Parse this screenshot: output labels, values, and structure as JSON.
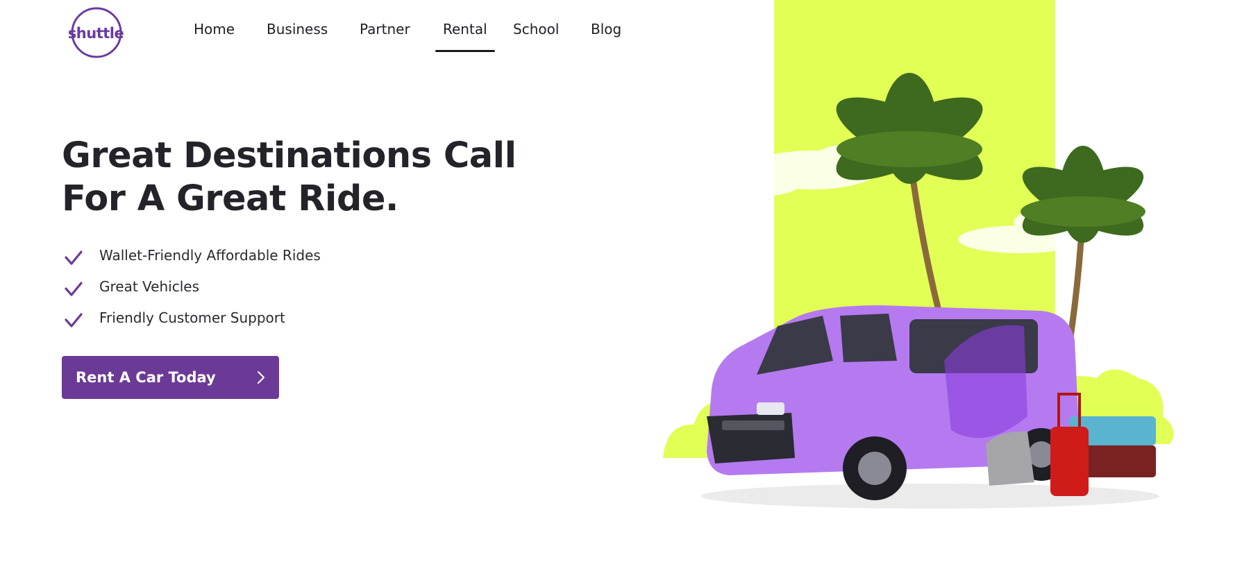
{
  "brand": {
    "logo_text": "shuttle",
    "color": "#6b3aa0"
  },
  "nav": {
    "items": [
      {
        "label": "Home",
        "active": false
      },
      {
        "label": "Business",
        "active": false
      },
      {
        "label": "Partner",
        "active": false
      },
      {
        "label": "Rental",
        "active": true
      },
      {
        "label": "School",
        "active": false
      },
      {
        "label": "Blog",
        "active": false
      }
    ]
  },
  "hero": {
    "title_line_1": "Great Destinations Call",
    "title_line_2": "For A Great Ride.",
    "features": [
      "Wallet-Friendly Affordable Rides",
      "Great Vehicles",
      "Friendly Customer Support"
    ],
    "cta_label": "Rent A Car Today"
  },
  "icons": {
    "check": "check-icon",
    "cta_arrow": "chevron-right-icon"
  },
  "colors": {
    "accent": "#6b3a96",
    "highlight": "#e2ff55",
    "van": "#b57af0"
  }
}
